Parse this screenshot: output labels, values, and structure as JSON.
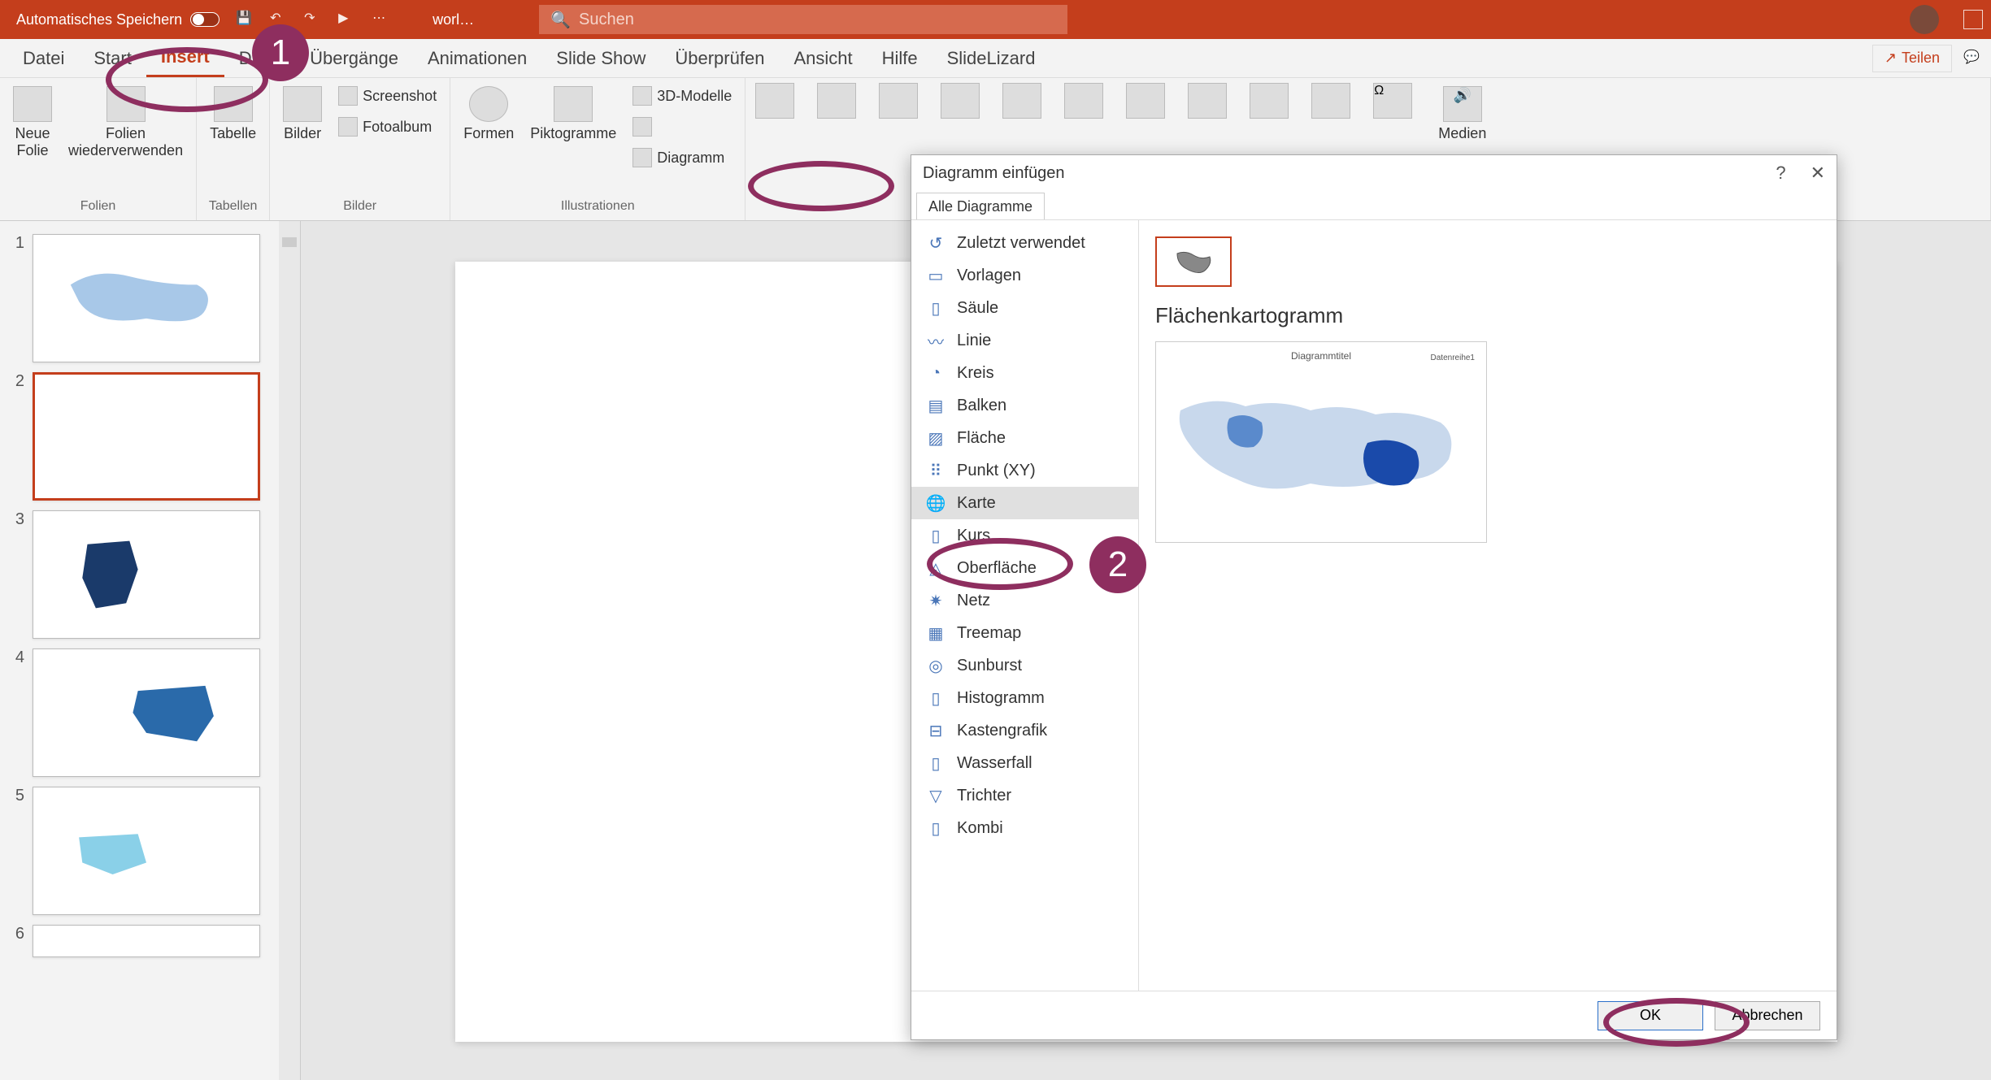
{
  "titlebar": {
    "autosave_label": "Automatisches Speichern",
    "doc_name": "worl…",
    "search_placeholder": "Suchen"
  },
  "tabs": {
    "items": [
      "Datei",
      "Start",
      "Insert",
      "Draw",
      "Übergänge",
      "Animationen",
      "Slide Show",
      "Überprüfen",
      "Ansicht",
      "Hilfe",
      "SlideLizard"
    ],
    "active_index": 2,
    "share_label": "Teilen"
  },
  "ribbon": {
    "groups": {
      "folien": {
        "label": "Folien",
        "new_slide": "Neue\nFolie",
        "reuse": "Folien\nwiederverwenden"
      },
      "tabellen": {
        "label": "Tabellen",
        "table": "Tabelle"
      },
      "bilder": {
        "label": "Bilder",
        "pictures": "Bilder",
        "screenshot": "Screenshot",
        "photoalbum": "Fotoalbum"
      },
      "illustrationen": {
        "label": "Illustrationen",
        "shapes": "Formen",
        "icons": "Piktogramme",
        "models3d": "3D-Modelle",
        "chart": "Diagramm"
      },
      "medien": {
        "label": "Medien"
      }
    }
  },
  "slides": {
    "count_visible": 6,
    "selected_index": 2
  },
  "dialog": {
    "title": "Diagramm einfügen",
    "tab_all": "Alle Diagramme",
    "preview_title": "Flächenkartogramm",
    "preview_chart_title": "Diagrammtitel",
    "preview_legend": "Datenreihe1",
    "ok": "OK",
    "cancel": "Abbrechen",
    "chart_types": [
      {
        "icon": "↺",
        "label": "Zuletzt verwendet"
      },
      {
        "icon": "▭",
        "label": "Vorlagen"
      },
      {
        "icon": "▯",
        "label": "Säule"
      },
      {
        "icon": "〰",
        "label": "Linie"
      },
      {
        "icon": "◔",
        "label": "Kreis"
      },
      {
        "icon": "▤",
        "label": "Balken"
      },
      {
        "icon": "▨",
        "label": "Fläche"
      },
      {
        "icon": "⠿",
        "label": "Punkt (XY)"
      },
      {
        "icon": "🌐",
        "label": "Karte"
      },
      {
        "icon": "▯",
        "label": "Kurs"
      },
      {
        "icon": "◬",
        "label": "Oberfläche"
      },
      {
        "icon": "✷",
        "label": "Netz"
      },
      {
        "icon": "▦",
        "label": "Treemap"
      },
      {
        "icon": "◎",
        "label": "Sunburst"
      },
      {
        "icon": "▯",
        "label": "Histogramm"
      },
      {
        "icon": "⊟",
        "label": "Kastengrafik"
      },
      {
        "icon": "▯",
        "label": "Wasserfall"
      },
      {
        "icon": "▽",
        "label": "Trichter"
      },
      {
        "icon": "▯",
        "label": "Kombi"
      }
    ],
    "selected_type_index": 8
  },
  "callouts": {
    "one": "1",
    "two": "2"
  }
}
